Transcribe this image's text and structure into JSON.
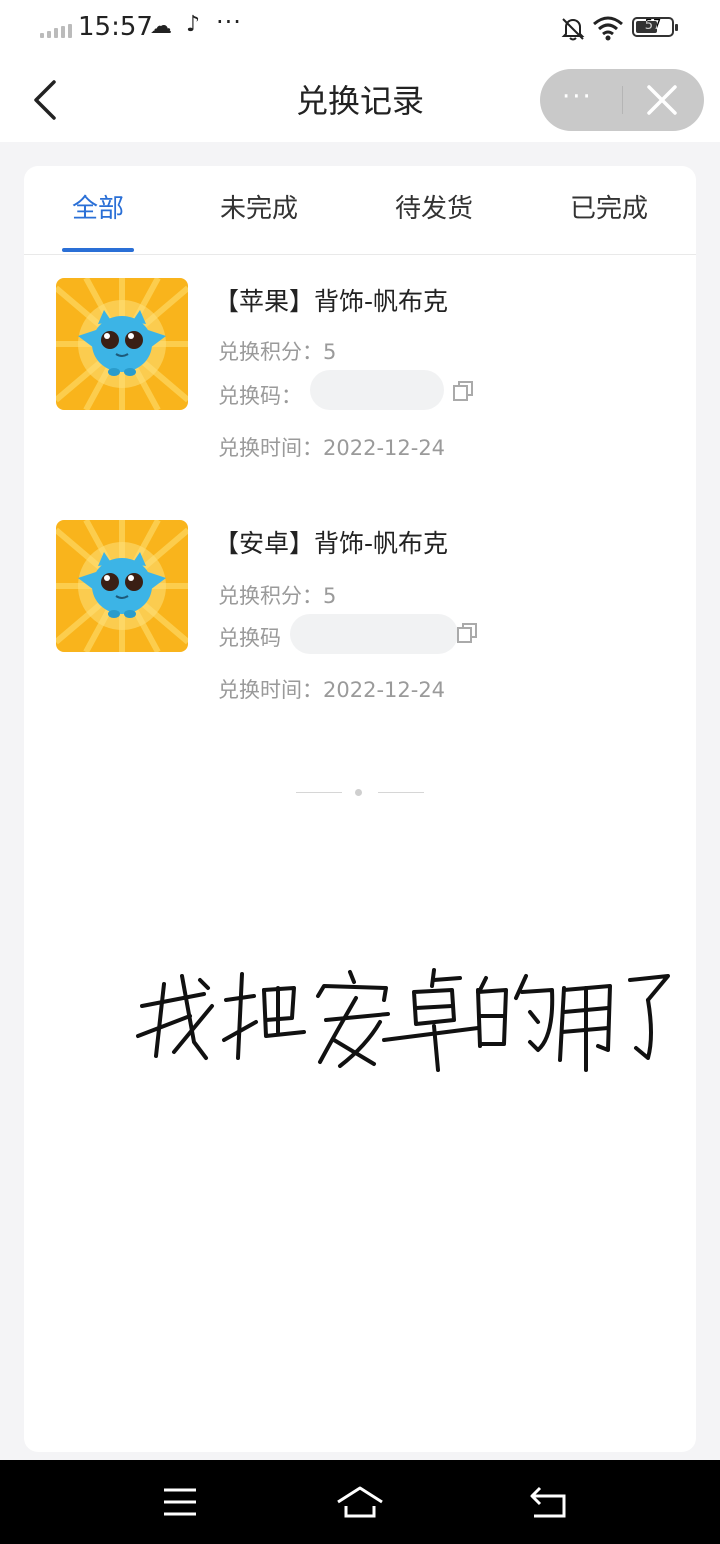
{
  "status_bar": {
    "time": "15:57",
    "icons": [
      "signal-icon",
      "cloud-icon",
      "tiktok-icon",
      "more-dots-icon",
      "bell-muted-icon",
      "wifi-icon"
    ],
    "battery": "57",
    "more": "···"
  },
  "nav": {
    "title": "兑换记录",
    "back_icon": "chevron-left-icon",
    "capsule_more": "···",
    "capsule_close_icon": "close-icon"
  },
  "tabs": [
    {
      "label": "全部",
      "active": true
    },
    {
      "label": "未完成",
      "active": false
    },
    {
      "label": "待发货",
      "active": false
    },
    {
      "label": "已完成",
      "active": false
    }
  ],
  "records": [
    {
      "title": "【苹果】背饰-帆布克",
      "points_label": "兑换积分：",
      "points": "5",
      "code_label": "兑换码：",
      "time_label": "兑换时间：",
      "time": "2022-12-24"
    },
    {
      "title": "【安卓】背饰-帆布克",
      "points_label": "兑换积分：",
      "points": "5",
      "code_label": "兑换码",
      "time_label": "兑换时间：",
      "time": "2022-12-24"
    }
  ],
  "handwriting": "我把安卓的用了",
  "colors": {
    "accent": "#2a6fd6",
    "thumb_bg": "#f9b41c",
    "creature": "#3cb4e6"
  },
  "system_nav": [
    "menu-icon",
    "home-icon",
    "back-icon"
  ]
}
